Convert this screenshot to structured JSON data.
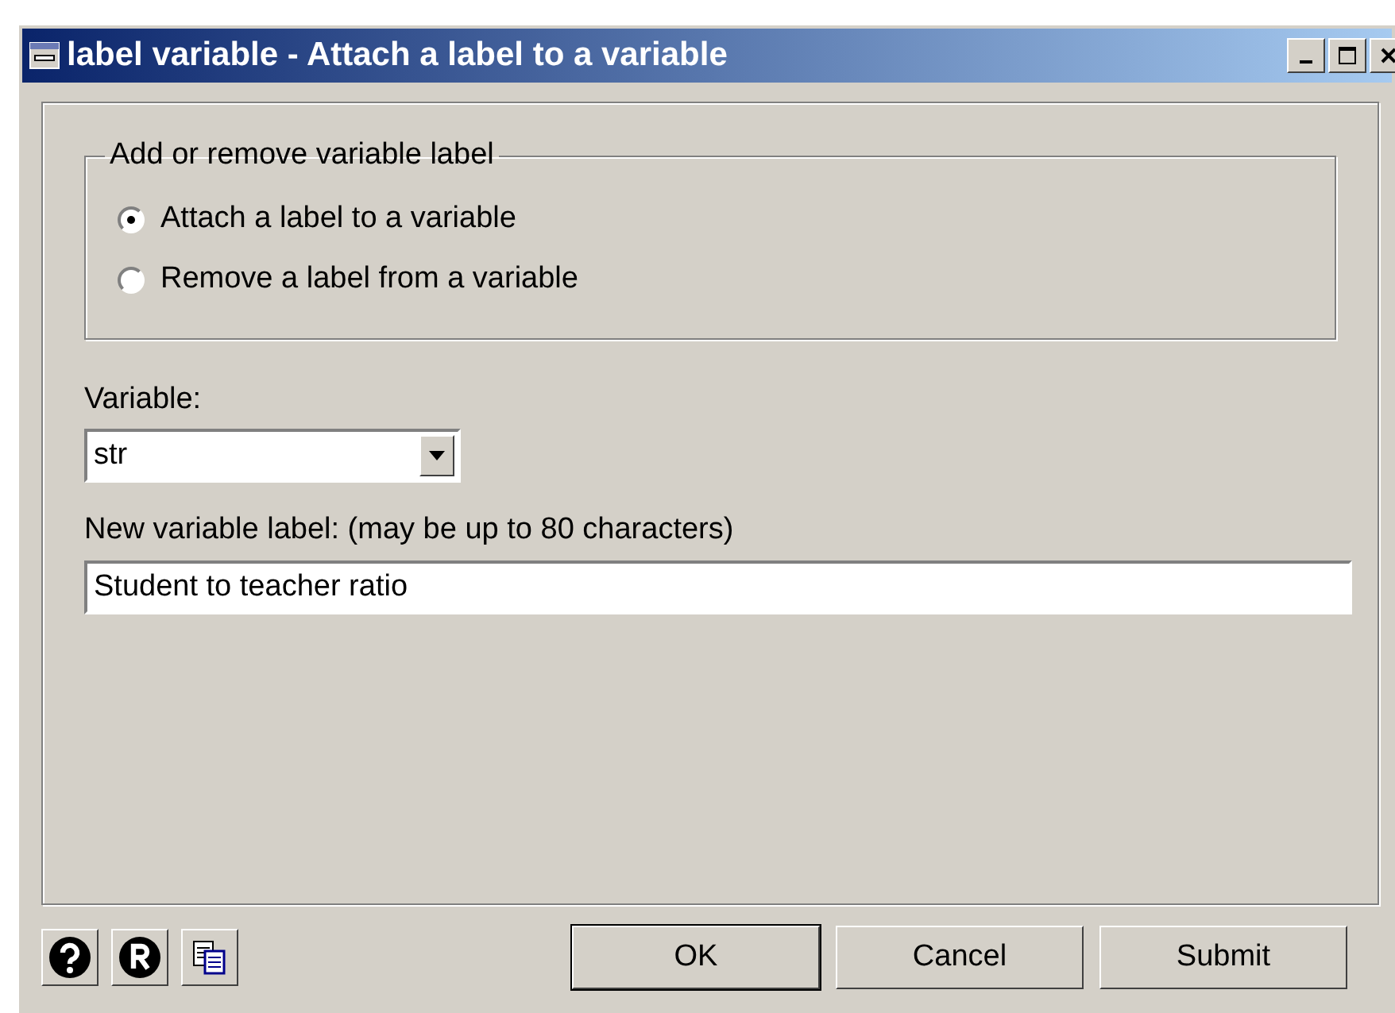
{
  "window": {
    "title": "label variable - Attach a label to a variable"
  },
  "group": {
    "legend": "Add or remove variable label",
    "options": [
      {
        "label": "Attach a label to a variable",
        "selected": true
      },
      {
        "label": "Remove a label from a variable",
        "selected": false
      }
    ]
  },
  "variable": {
    "label": "Variable:",
    "value": "str"
  },
  "new_label": {
    "label": "New variable label: (may be up to 80 characters)",
    "value": "Student to teacher ratio"
  },
  "tool_buttons": [
    {
      "kind": "help"
    },
    {
      "kind": "reset"
    },
    {
      "kind": "copy"
    }
  ],
  "buttons": [
    {
      "label": "OK",
      "default": true
    },
    {
      "label": "Cancel",
      "default": false
    },
    {
      "label": "Submit",
      "default": false
    }
  ]
}
